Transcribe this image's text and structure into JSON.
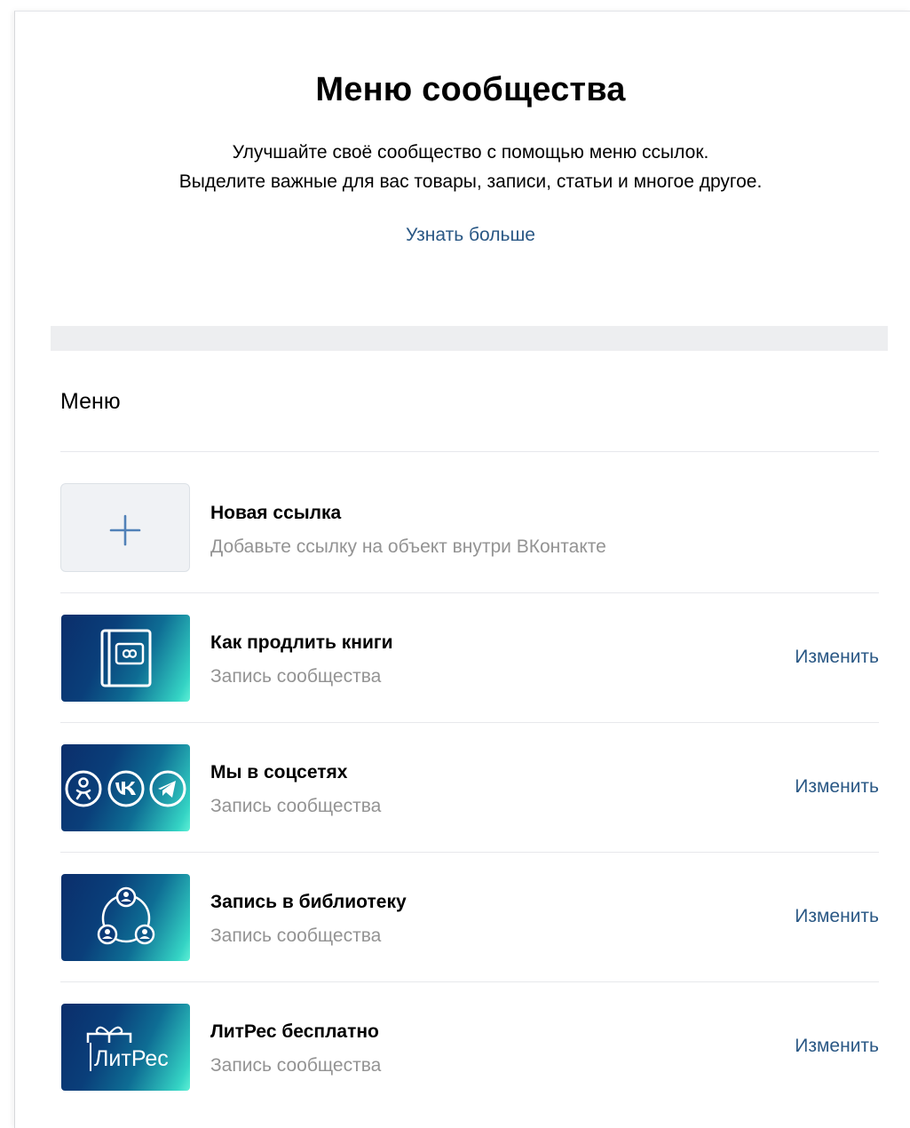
{
  "header": {
    "title": "Меню сообщества",
    "description_line1": "Улучшайте своё сообщество с помощью меню ссылок.",
    "description_line2": "Выделите важные для вас товары, записи, статьи и многое другое.",
    "learn_more": "Узнать больше"
  },
  "menu": {
    "label": "Меню",
    "new_link": {
      "title": "Новая ссылка",
      "subtitle": "Добавьте ссылку на объект внутри ВКонтакте",
      "icon": "plus-icon"
    },
    "items": [
      {
        "title": "Как продлить книги",
        "subtitle": "Запись сообщества",
        "edit": "Изменить",
        "thumb_icon": "book-infinity-icon"
      },
      {
        "title": "Мы в соцсетях",
        "subtitle": "Запись сообщества",
        "edit": "Изменить",
        "thumb_icon": "social-networks-icon"
      },
      {
        "title": "Запись в библиотеку",
        "subtitle": "Запись сообщества",
        "edit": "Изменить",
        "thumb_icon": "community-people-icon"
      },
      {
        "title": "ЛитРес бесплатно",
        "subtitle": "Запись сообщества",
        "edit": "Изменить",
        "thumb_icon": "litres-gift-icon",
        "thumb_text": "ЛитРес"
      }
    ]
  },
  "colors": {
    "link": "#2a5885",
    "secondary_text": "#939393",
    "band": "#edeef0",
    "accent_plus": "#5181b8"
  }
}
